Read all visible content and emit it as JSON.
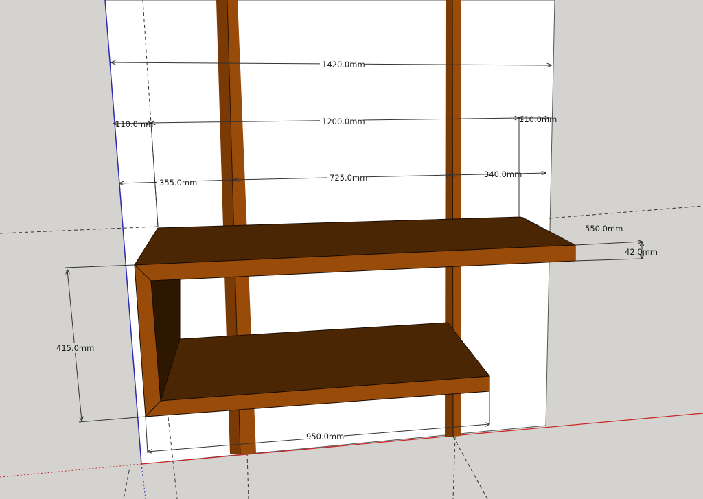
{
  "viewport": {
    "background": "#d4d3d0",
    "wall_color": "#ffffff",
    "shelf_top_color": "#4a2604",
    "shelf_front_color": "#994b0a",
    "shelf_inner_color": "#2e1700",
    "upright_color": "#994b0a",
    "axis_red": "#cc2222",
    "axis_blue": "#2b2bb5",
    "dimension_color": "#333333"
  },
  "dimensions": {
    "overall_width": "1420.0mm",
    "inner_width": "1200.0mm",
    "left_margin": "110.0mm",
    "right_margin": "110.0mm",
    "left_offset": "355.0mm",
    "upright_spacing": "725.0mm",
    "right_offset": "340.0mm",
    "shelf_depth": "550.0mm",
    "shelf_thickness": "42.0mm",
    "shelf_gap": "415.0mm",
    "lower_shelf_width": "950.0mm"
  }
}
